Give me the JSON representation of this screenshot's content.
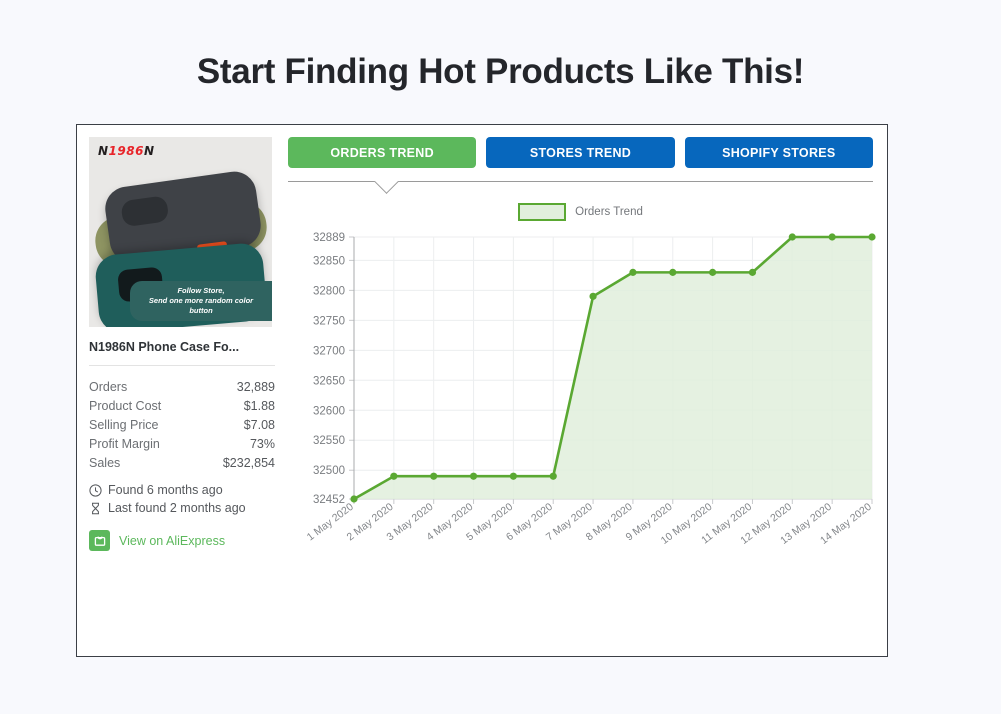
{
  "page": {
    "heading": "Start Finding Hot Products Like This!",
    "background_color": "#f8f9fd"
  },
  "product": {
    "brand_logo": "N1986N",
    "photo_caption_line1": "Follow Store,",
    "photo_caption_line2": "Send one more random color button",
    "title": "N1986N Phone Case Fo...",
    "metrics": [
      {
        "label": "Orders",
        "value": "32,889"
      },
      {
        "label": "Product Cost",
        "value": "$1.88"
      },
      {
        "label": "Selling Price",
        "value": "$7.08"
      },
      {
        "label": "Profit Margin",
        "value": "73%"
      },
      {
        "label": "Sales",
        "value": "$232,854"
      }
    ],
    "found": "Found 6 months ago",
    "last_found": "Last found 2 months ago",
    "aliexpress_link": "View on AliExpress"
  },
  "tabs": [
    {
      "label": "ORDERS TREND",
      "active": true,
      "color": "#5cb85c"
    },
    {
      "label": "STORES TREND",
      "active": false,
      "color": "#0767bd"
    },
    {
      "label": "SHOPIFY STORES",
      "active": false,
      "color": "#0767bd"
    }
  ],
  "chart_data": {
    "type": "line",
    "title": "",
    "xlabel": "",
    "ylabel": "",
    "legend": [
      "Orders Trend"
    ],
    "legend_position": "top-center",
    "grid": true,
    "line_color": "#5aa832",
    "fill_color": "#e1efdc",
    "ylim": [
      32452,
      32889
    ],
    "yticks": [
      32452,
      32500,
      32550,
      32600,
      32650,
      32700,
      32750,
      32800,
      32850,
      32889
    ],
    "categories": [
      "1 May 2020",
      "2 May 2020",
      "3 May 2020",
      "4 May 2020",
      "5 May 2020",
      "6 May 2020",
      "7 May 2020",
      "8 May 2020",
      "9 May 2020",
      "10 May 2020",
      "11 May 2020",
      "12 May 2020",
      "13 May 2020",
      "14 May 2020"
    ],
    "series": [
      {
        "name": "Orders Trend",
        "values": [
          32452,
          32490,
          32490,
          32490,
          32490,
          32490,
          32790,
          32830,
          32830,
          32830,
          32830,
          32889,
          32889,
          32889
        ]
      }
    ]
  }
}
